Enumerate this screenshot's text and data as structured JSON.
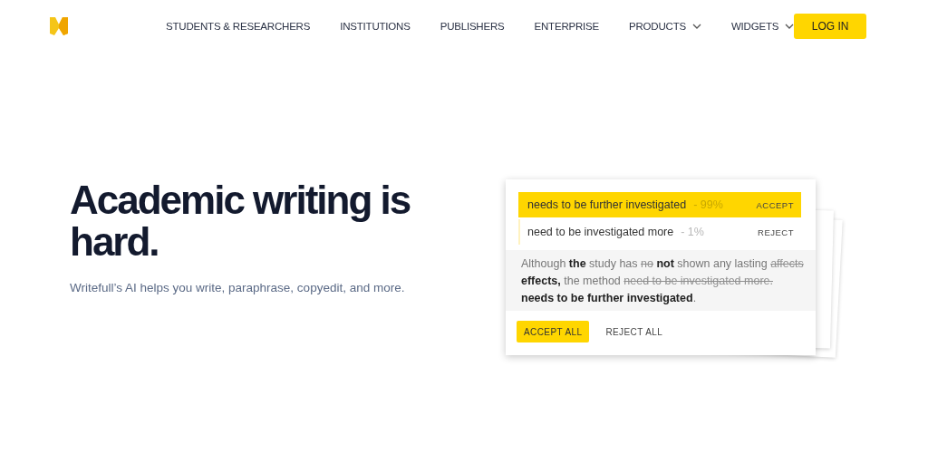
{
  "nav": {
    "items": [
      {
        "label": "STUDENTS & RESEARCHERS",
        "dropdown": false
      },
      {
        "label": "INSTITUTIONS",
        "dropdown": false
      },
      {
        "label": "PUBLISHERS",
        "dropdown": false
      },
      {
        "label": "ENTERPRISE",
        "dropdown": false
      },
      {
        "label": "PRODUCTS",
        "dropdown": true
      },
      {
        "label": "WIDGETS",
        "dropdown": true
      }
    ],
    "login": "LOG IN"
  },
  "hero": {
    "title": "Academic writing is hard.",
    "subtitle": "Writefull’s AI helps you write, paraphrase, copyedit, and more."
  },
  "card": {
    "suggestions": [
      {
        "text": "needs to be further investigated",
        "score": "- 99%",
        "action": "ACCEPT",
        "selected": true
      },
      {
        "text": "need to be investigated more",
        "score": "- 1%",
        "action": "REJECT",
        "selected": false
      }
    ],
    "sentence": [
      {
        "text": "Although ",
        "kind": "plain"
      },
      {
        "text": "the",
        "kind": "added"
      },
      {
        "text": " study has ",
        "kind": "plain"
      },
      {
        "text": "no",
        "kind": "removed"
      },
      {
        "text": " not",
        "kind": "added"
      },
      {
        "text": " shown any lasting ",
        "kind": "plain"
      },
      {
        "text": "affects",
        "kind": "removed"
      },
      {
        "text": " effects,",
        "kind": "added"
      },
      {
        "text": " the method ",
        "kind": "plain"
      },
      {
        "text": "need to be investigated more.",
        "kind": "removed"
      },
      {
        "text": " needs to be further investigated",
        "kind": "added"
      },
      {
        "text": ".",
        "kind": "plain"
      }
    ],
    "accept_all": "ACCEPT ALL",
    "reject_all": "REJECT ALL"
  }
}
